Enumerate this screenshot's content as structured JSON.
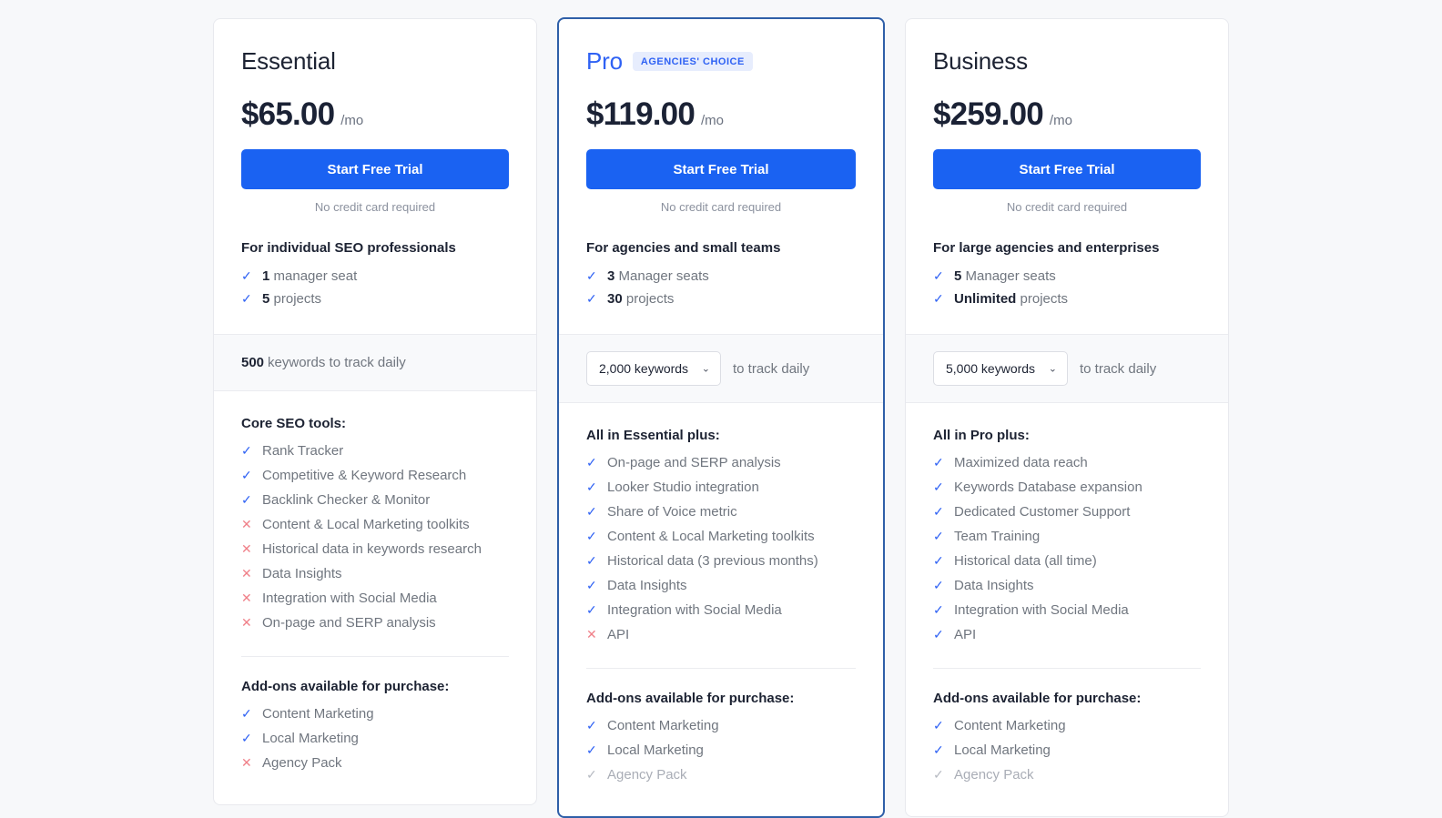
{
  "theme": {
    "page_background": "#f7f8fa",
    "accent_blue": "#2f62f4",
    "button_blue": "#1a62f2",
    "featured_border": "#2f5fa8",
    "check_color": "#2f62f4",
    "cross_color": "#f08089",
    "muted_color": "#b6bac2"
  },
  "icons": {
    "check": "check-icon",
    "cross": "cross-icon",
    "chevron": "chevron-down-icon",
    "check_glyph": "✓",
    "cross_glyph": "✕",
    "chevron_glyph": "⌄"
  },
  "plans": [
    {
      "id": "essential",
      "name": "Essential",
      "featured": false,
      "badge": null,
      "price": "$65.00",
      "price_period": "/mo",
      "cta_label": "Start Free Trial",
      "cta_note": "No credit card required",
      "audience": "For individual SEO professionals",
      "specs": [
        {
          "mark": "yes",
          "qty": "1",
          "text": "manager seat"
        },
        {
          "mark": "yes",
          "qty": "5",
          "text": "projects"
        }
      ],
      "keywords": {
        "type": "static",
        "qty": "500",
        "label": "keywords to track daily",
        "selected": null,
        "options": [],
        "suffix": null
      },
      "features_title": "Core SEO tools:",
      "features": [
        {
          "mark": "yes",
          "text": "Rank Tracker"
        },
        {
          "mark": "yes",
          "text": "Competitive & Keyword Research"
        },
        {
          "mark": "yes",
          "text": "Backlink Checker & Monitor"
        },
        {
          "mark": "no",
          "text": "Content & Local Marketing toolkits"
        },
        {
          "mark": "no",
          "text": "Historical data in keywords research"
        },
        {
          "mark": "no",
          "text": "Data Insights"
        },
        {
          "mark": "no",
          "text": "Integration with Social Media"
        },
        {
          "mark": "no",
          "text": "On-page and SERP analysis"
        }
      ],
      "addons_title": "Add-ons available for purchase:",
      "addons": [
        {
          "mark": "yes",
          "text": "Content Marketing",
          "dim": false
        },
        {
          "mark": "yes",
          "text": "Local Marketing",
          "dim": false
        },
        {
          "mark": "no",
          "text": "Agency Pack",
          "dim": false
        }
      ]
    },
    {
      "id": "pro",
      "name": "Pro",
      "featured": true,
      "badge": "AGENCIES' CHOICE",
      "price": "$119.00",
      "price_period": "/mo",
      "cta_label": "Start Free Trial",
      "cta_note": "No credit card required",
      "audience": "For agencies and small teams",
      "specs": [
        {
          "mark": "yes",
          "qty": "3",
          "text": "Manager seats"
        },
        {
          "mark": "yes",
          "qty": "30",
          "text": "projects"
        }
      ],
      "keywords": {
        "type": "select",
        "qty": null,
        "label": null,
        "selected": "2,000 keywords",
        "options": [
          "2,000 keywords"
        ],
        "suffix": "to track daily"
      },
      "features_title": "All in Essential plus:",
      "features": [
        {
          "mark": "yes",
          "text": "On-page and SERP analysis"
        },
        {
          "mark": "yes",
          "text": "Looker Studio integration"
        },
        {
          "mark": "yes",
          "text": "Share of Voice metric"
        },
        {
          "mark": "yes",
          "text": "Content & Local Marketing toolkits"
        },
        {
          "mark": "yes",
          "text": "Historical data (3 previous months)"
        },
        {
          "mark": "yes",
          "text": "Data Insights"
        },
        {
          "mark": "yes",
          "text": "Integration with Social Media"
        },
        {
          "mark": "no",
          "text": "API"
        }
      ],
      "addons_title": "Add-ons available for purchase:",
      "addons": [
        {
          "mark": "yes",
          "text": "Content Marketing",
          "dim": false
        },
        {
          "mark": "yes",
          "text": "Local Marketing",
          "dim": false
        },
        {
          "mark": "muted",
          "text": "Agency Pack",
          "dim": true
        }
      ]
    },
    {
      "id": "business",
      "name": "Business",
      "featured": false,
      "badge": null,
      "price": "$259.00",
      "price_period": "/mo",
      "cta_label": "Start Free Trial",
      "cta_note": "No credit card required",
      "audience": "For large agencies and enterprises",
      "specs": [
        {
          "mark": "yes",
          "qty": "5",
          "text": "Manager seats"
        },
        {
          "mark": "yes",
          "qty": "Unlimited",
          "text": "projects"
        }
      ],
      "keywords": {
        "type": "select",
        "qty": null,
        "label": null,
        "selected": "5,000 keywords",
        "options": [
          "5,000 keywords"
        ],
        "suffix": "to track daily"
      },
      "features_title": "All in Pro plus:",
      "features": [
        {
          "mark": "yes",
          "text": "Maximized data reach"
        },
        {
          "mark": "yes",
          "text": "Keywords Database expansion"
        },
        {
          "mark": "yes",
          "text": "Dedicated Customer Support"
        },
        {
          "mark": "yes",
          "text": "Team Training"
        },
        {
          "mark": "yes",
          "text": "Historical data (all time)"
        },
        {
          "mark": "yes",
          "text": "Data Insights"
        },
        {
          "mark": "yes",
          "text": "Integration with Social Media"
        },
        {
          "mark": "yes",
          "text": "API"
        }
      ],
      "addons_title": "Add-ons available for purchase:",
      "addons": [
        {
          "mark": "yes",
          "text": "Content Marketing",
          "dim": false
        },
        {
          "mark": "yes",
          "text": "Local Marketing",
          "dim": false
        },
        {
          "mark": "muted",
          "text": "Agency Pack",
          "dim": true
        }
      ]
    }
  ]
}
